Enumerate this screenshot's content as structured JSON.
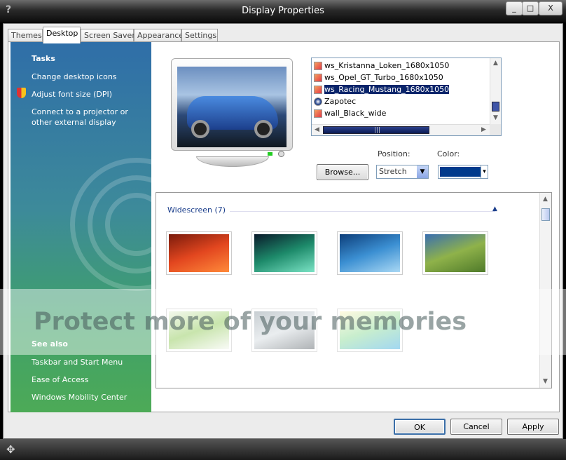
{
  "window": {
    "title": "Display Properties",
    "help_glyph": "?",
    "minimize": "_",
    "maximize": "□",
    "close": "X"
  },
  "tabs": [
    {
      "label": "Themes"
    },
    {
      "label": "Desktop"
    },
    {
      "label": "Screen Saver"
    },
    {
      "label": "Appearance"
    },
    {
      "label": "Settings"
    }
  ],
  "sidebar": {
    "tasks_heading": "Tasks",
    "tasks": [
      {
        "label": "Change desktop icons"
      },
      {
        "label": "Adjust font size (DPI)",
        "icon": "shield-icon"
      },
      {
        "label": "Connect to a projector or other external display"
      }
    ],
    "see_also_heading": "See also",
    "see_also": [
      {
        "label": "Taskbar and Start Menu"
      },
      {
        "label": "Ease of Access"
      },
      {
        "label": "Windows Mobility Center"
      }
    ]
  },
  "backgrounds_list": {
    "items": [
      {
        "label": "ws_Kristanna_Loken_1680x1050",
        "icon": "image-icon"
      },
      {
        "label": "ws_Opel_GT_Turbo_1680x1050",
        "icon": "image-icon"
      },
      {
        "label": "ws_Racing_Mustang_1680x1050",
        "icon": "image-icon",
        "selected": true
      },
      {
        "label": "Zapotec",
        "icon": "theme-icon"
      },
      {
        "label": "wall_Black_wide",
        "icon": "image-icon"
      }
    ],
    "scroll_grip": "|||"
  },
  "controls": {
    "position_label": "Position:",
    "color_label": "Color:",
    "browse_label": "Browse...",
    "position_value": "Stretch",
    "color_value": "#003a8c"
  },
  "gallery": {
    "group_label": "Widescreen (7)",
    "collapse_glyph": "▲",
    "thumbnails": [
      {
        "name": "red-flower",
        "colors": [
          "#7a1b0c",
          "#e2461f",
          "#ff8a3a"
        ]
      },
      {
        "name": "aurora",
        "colors": [
          "#0a1a2a",
          "#1d8a6a",
          "#7be3c5"
        ]
      },
      {
        "name": "fish",
        "colors": [
          "#0d3e7a",
          "#3b8fd2",
          "#a9d8f4"
        ]
      },
      {
        "name": "green-hills",
        "colors": [
          "#3a6fb0",
          "#8fb24a",
          "#4f7a2a"
        ]
      },
      {
        "name": "leaf",
        "colors": [
          "#e8f2dc",
          "#9ccf6a",
          "#f4f7f0"
        ]
      },
      {
        "name": "winter-shore",
        "colors": [
          "#9aa6ad",
          "#d9dfe3",
          "#6e757a"
        ]
      },
      {
        "name": "vista-aurora",
        "colors": [
          "#fff6c9",
          "#9be0a5",
          "#56b7e6"
        ]
      }
    ]
  },
  "watermark_text": "Protect more of your memories",
  "footer": {
    "ok_label": "OK",
    "cancel_label": "Cancel",
    "apply_label": "Apply"
  },
  "accent_colors": {
    "selection": "#0a246a",
    "link": "#1c3f8c",
    "sidebar_top": "#2f6ea8",
    "sidebar_bottom": "#4daa57"
  }
}
